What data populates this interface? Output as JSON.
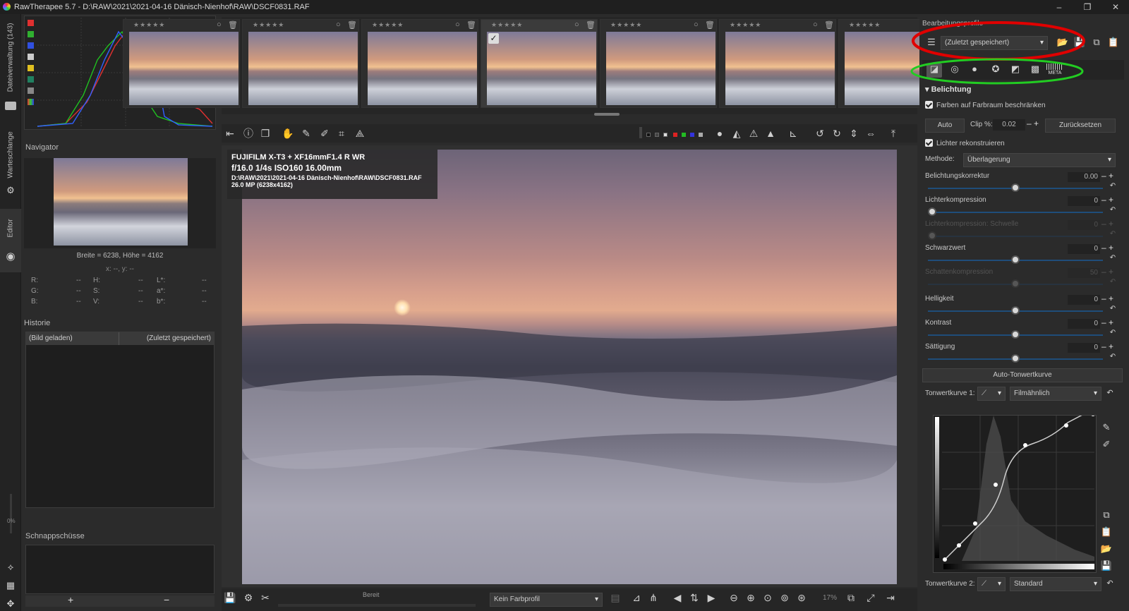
{
  "window": {
    "title": "RawTherapee 5.7 - D:\\RAW\\2021\\2021-04-16 Dänisch-Nienhof\\RAW\\DSCF0831.RAF",
    "minimize": "–",
    "maximize": "❐",
    "close": "✕"
  },
  "left_tabs": {
    "file_browser": "Dateiverwaltung (143)",
    "queue": "Warteschlange",
    "editor": "Editor"
  },
  "navigator": {
    "title": "Navigator",
    "dimensions": "Breite = 6238, Höhe = 4162",
    "coords": "x: --, y: --",
    "rows": [
      [
        "R:",
        "--",
        "H:",
        "--",
        "L*:",
        "--"
      ],
      [
        "G:",
        "--",
        "S:",
        "--",
        "a*:",
        "--"
      ],
      [
        "B:",
        "--",
        "V:",
        "--",
        "b*:",
        "--"
      ]
    ]
  },
  "history": {
    "title": "Historie",
    "row": {
      "left": "(Bild geladen)",
      "right": "(Zuletzt gespeichert)"
    }
  },
  "snapshots": {
    "title": "Schnappschüsse",
    "add": "+",
    "remove": "−"
  },
  "histogram": {
    "percent": "0%"
  },
  "filmstrip": {
    "thumbs": [
      {
        "selected": false,
        "checked": false
      },
      {
        "selected": false,
        "checked": false
      },
      {
        "selected": false,
        "checked": false
      },
      {
        "selected": true,
        "checked": true
      },
      {
        "selected": false,
        "checked": false
      },
      {
        "selected": false,
        "checked": false
      },
      {
        "selected": false,
        "checked": false
      }
    ],
    "stars": "★★★★★"
  },
  "exif": {
    "camera": "FUJIFILM X-T3 + XF16mmF1.4 R WR",
    "exposure": "f/16.0  1/4s  ISO160  16.00mm",
    "path": "D:\\RAW\\2021\\2021-04-16 Dänisch-Nienhof\\RAW\\DSCF0831.RAF",
    "size": "26.0 MP (6238x4162)"
  },
  "statusbar": {
    "status": "Bereit",
    "color_profile": "Kein Farbprofil",
    "zoom": "17%"
  },
  "right": {
    "profile_title": "Bearbeitungsprofile",
    "profile_value": "(Zuletzt gespeichert)",
    "section_title": "Belichtung",
    "clip_gamut": "Farben auf Farbraum beschränken",
    "auto": "Auto",
    "clip_label": "Clip %:",
    "clip_value": "0.02",
    "reset": "Zurücksetzen",
    "reconstruct": "Lichter rekonstruieren",
    "method_label": "Methode:",
    "method_value": "Überlagerung",
    "sliders": [
      {
        "label": "Belichtungskorrektur",
        "value": "0.00",
        "enabled": true,
        "position": 0.5
      },
      {
        "label": "Lichterkompression",
        "value": "0",
        "enabled": true,
        "position": 0.0
      },
      {
        "label": "Lichterkompression: Schwelle",
        "value": "0",
        "enabled": false,
        "position": 0.0
      },
      {
        "label": "Schwarzwert",
        "value": "0",
        "enabled": true,
        "position": 0.5
      },
      {
        "label": "Schattenkompression",
        "value": "50",
        "enabled": false,
        "position": 0.5
      },
      {
        "label": "Helligkeit",
        "value": "0",
        "enabled": true,
        "position": 0.5
      },
      {
        "label": "Kontrast",
        "value": "0",
        "enabled": true,
        "position": 0.5
      },
      {
        "label": "Sättigung",
        "value": "0",
        "enabled": true,
        "position": 0.5
      }
    ],
    "auto_tone_curve": "Auto-Tonwertkurve",
    "tone_curve_1_label": "Tonwertkurve 1:",
    "tone_curve_1_value": "Filmähnlich",
    "tone_curve_2_label": "Tonwertkurve 2:",
    "tone_curve_2_value": "Standard",
    "meta_tab": "META"
  },
  "annotations": {
    "red": "#e00000",
    "green": "#22cc22"
  }
}
